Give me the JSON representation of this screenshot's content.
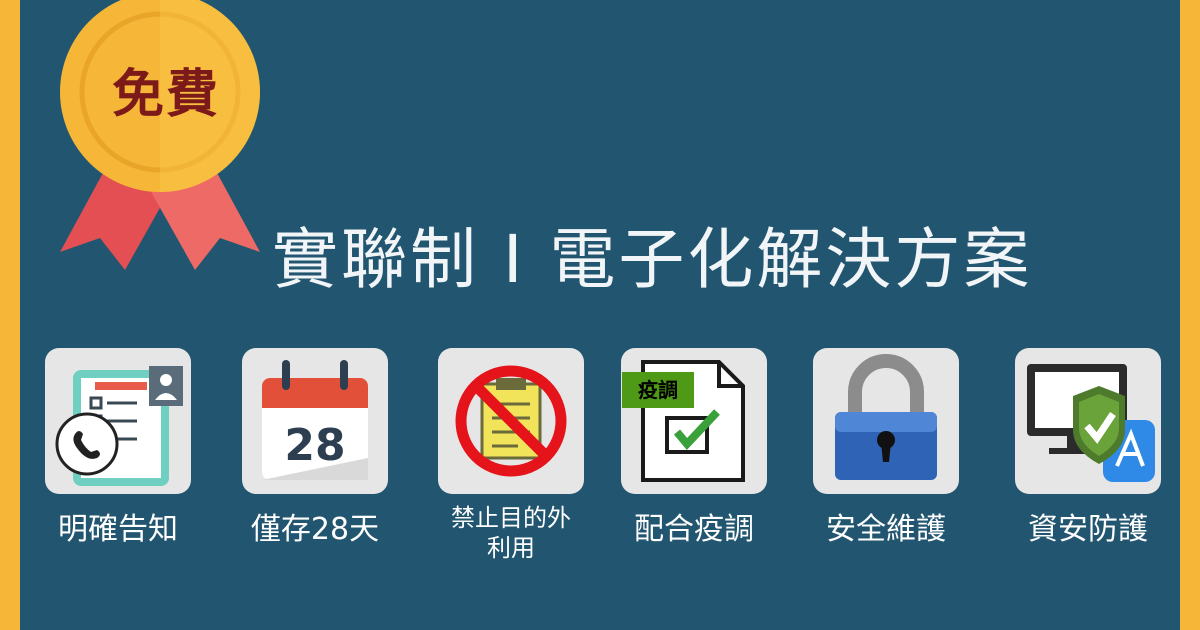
{
  "badge": {
    "text": "免費"
  },
  "title": "實聯制 I 電子化解決方案",
  "features": [
    {
      "label": "明確告知",
      "icon": "checklist-phone-icon"
    },
    {
      "label": "僅存28天",
      "icon": "calendar-icon",
      "calendar_day": "28"
    },
    {
      "label": "禁止目的外\n利用",
      "icon": "prohibited-document-icon"
    },
    {
      "label": "配合疫調",
      "icon": "epidemic-document-icon",
      "tag": "疫調"
    },
    {
      "label": "安全維護",
      "icon": "padlock-icon"
    },
    {
      "label": "資安防護",
      "icon": "secure-monitor-icon"
    }
  ],
  "colors": {
    "background": "#215570",
    "border": "#f6b637",
    "badge_gold": "#f6b637",
    "badge_ribbon": "#e85a5a",
    "tile": "#e6e6e6"
  }
}
